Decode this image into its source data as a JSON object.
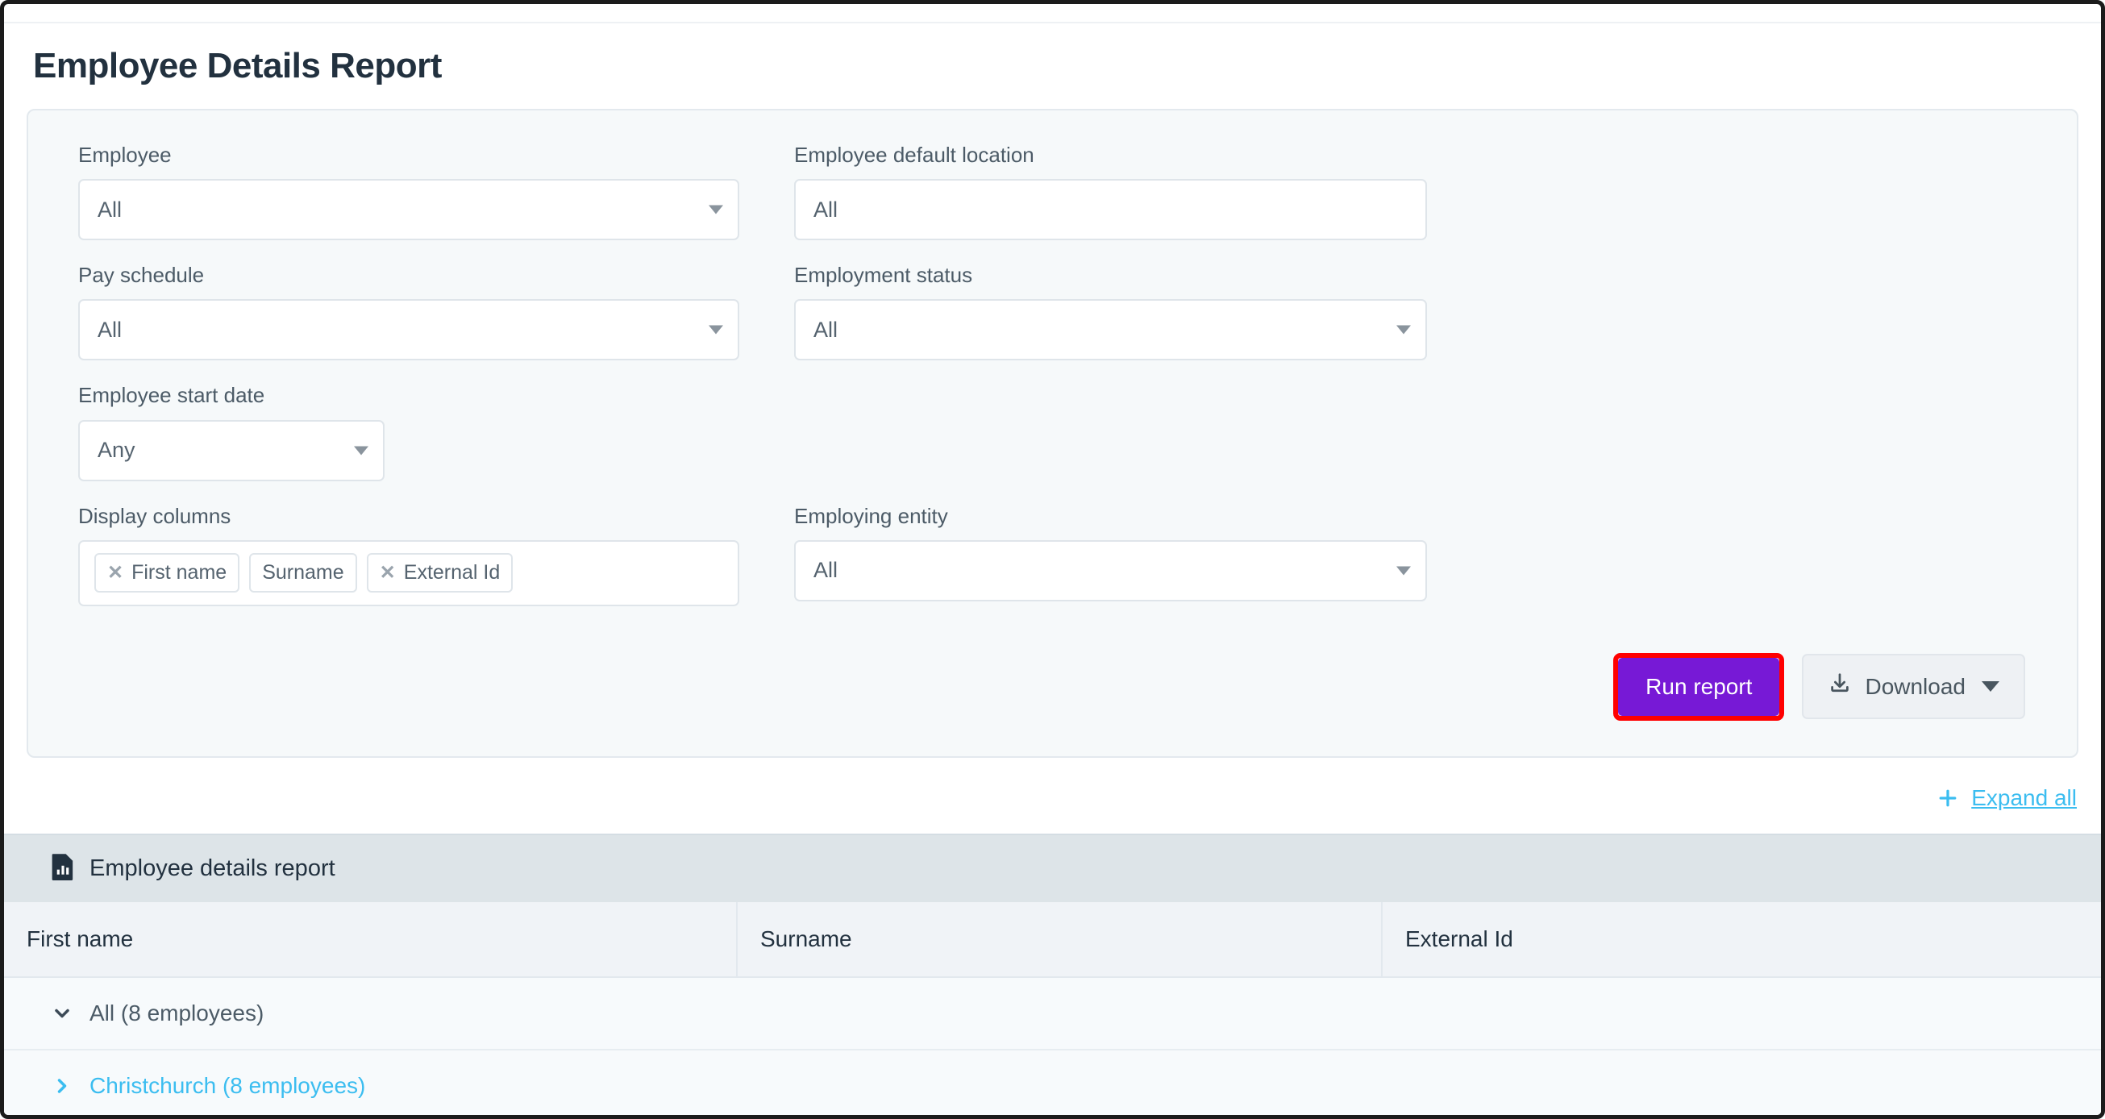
{
  "page": {
    "title": "Employee Details Report"
  },
  "filters": {
    "employee": {
      "label": "Employee",
      "value": "All"
    },
    "employee_default_location": {
      "label": "Employee default location",
      "value": "All"
    },
    "pay_schedule": {
      "label": "Pay schedule",
      "value": "All"
    },
    "employment_status": {
      "label": "Employment status",
      "value": "All"
    },
    "employee_start_date": {
      "label": "Employee start date",
      "value": "Any"
    },
    "display_columns": {
      "label": "Display columns",
      "chips": [
        {
          "label": "First name",
          "removable": true
        },
        {
          "label": "Surname",
          "removable": false
        },
        {
          "label": "External Id",
          "removable": true
        }
      ]
    },
    "employing_entity": {
      "label": "Employing entity",
      "value": "All"
    }
  },
  "actions": {
    "run_report": "Run report",
    "download": "Download",
    "highlight_color": "#ff0000",
    "run_button_color": "#7719d6"
  },
  "expand": {
    "label": "Expand all"
  },
  "report": {
    "title": "Employee details report",
    "columns": [
      "First name",
      "Surname",
      "External Id"
    ],
    "rows": [
      {
        "label": "All (8 employees)",
        "state": "expanded",
        "style": "dark"
      },
      {
        "label": "Christchurch (8 employees)",
        "state": "collapsed",
        "style": "link"
      }
    ]
  },
  "colors": {
    "accent_blue": "#3bbdf0",
    "heading": "#22313f",
    "panel_bg": "#f6f9fa"
  }
}
